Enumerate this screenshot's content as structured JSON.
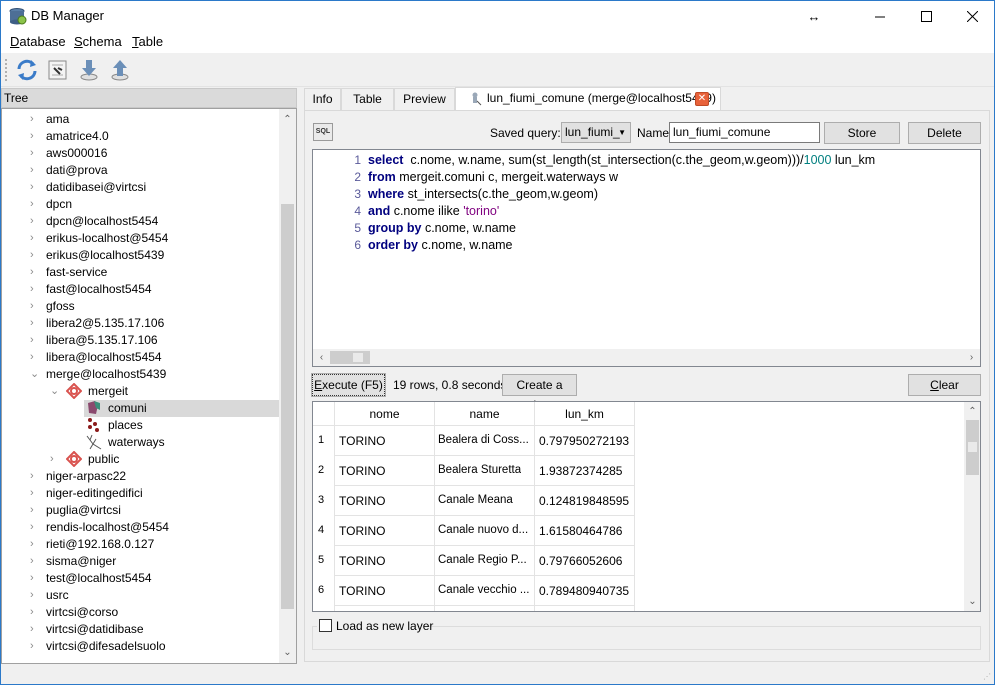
{
  "window": {
    "title": "DB Manager",
    "controls": {
      "resize": "↔",
      "minimize": "—",
      "maximize": "☐",
      "close": "✕"
    }
  },
  "menubar": {
    "items": [
      {
        "label_ul": "D",
        "label_rest": "atabase"
      },
      {
        "label_ul": "S",
        "label_rest": "chema"
      },
      {
        "label_ul": "T",
        "label_rest": "able"
      }
    ]
  },
  "toolbar": {
    "icons": [
      "refresh-icon",
      "sql-window-icon",
      "import-layer-icon",
      "export-layer-icon"
    ]
  },
  "tree": {
    "header": "Tree",
    "items": [
      {
        "label": "ama",
        "level": 0,
        "arrow": "›"
      },
      {
        "label": "amatrice4.0",
        "level": 0,
        "arrow": "›"
      },
      {
        "label": "aws000016",
        "level": 0,
        "arrow": "›"
      },
      {
        "label": "dati@prova",
        "level": 0,
        "arrow": "›"
      },
      {
        "label": "datidibasei@virtcsi",
        "level": 0,
        "arrow": "›"
      },
      {
        "label": "dpcn",
        "level": 0,
        "arrow": "›"
      },
      {
        "label": "dpcn@localhost5454",
        "level": 0,
        "arrow": "›"
      },
      {
        "label": "erikus-localhost@5454",
        "level": 0,
        "arrow": "›"
      },
      {
        "label": "erikus@localhost5439",
        "level": 0,
        "arrow": "›"
      },
      {
        "label": "fast-service",
        "level": 0,
        "arrow": "›"
      },
      {
        "label": "fast@localhost5454",
        "level": 0,
        "arrow": "›"
      },
      {
        "label": "gfoss",
        "level": 0,
        "arrow": "›"
      },
      {
        "label": "libera2@5.135.17.106",
        "level": 0,
        "arrow": "›"
      },
      {
        "label": "libera@5.135.17.106",
        "level": 0,
        "arrow": "›"
      },
      {
        "label": "libera@localhost5454",
        "level": 0,
        "arrow": "›"
      },
      {
        "label": "merge@localhost5439",
        "level": 0,
        "arrow": "⌄"
      },
      {
        "label": "mergeit",
        "level": 1,
        "arrow": "⌄",
        "icon": "schema-icon"
      },
      {
        "label": "comuni",
        "level": 2,
        "arrow": "",
        "icon": "polygon-layer-icon",
        "selected": true
      },
      {
        "label": "places",
        "level": 2,
        "arrow": "",
        "icon": "point-layer-icon"
      },
      {
        "label": "waterways",
        "level": 2,
        "arrow": "",
        "icon": "line-layer-icon"
      },
      {
        "label": "public",
        "level": 1,
        "arrow": "›",
        "icon": "schema-icon"
      },
      {
        "label": "niger-arpasc22",
        "level": 0,
        "arrow": "›"
      },
      {
        "label": "niger-editingedifici",
        "level": 0,
        "arrow": "›"
      },
      {
        "label": "puglia@virtcsi",
        "level": 0,
        "arrow": "›"
      },
      {
        "label": "rendis-localhost@5454",
        "level": 0,
        "arrow": "›"
      },
      {
        "label": "rieti@192.168.0.127",
        "level": 0,
        "arrow": "›"
      },
      {
        "label": "sisma@niger",
        "level": 0,
        "arrow": "›"
      },
      {
        "label": "test@localhost5454",
        "level": 0,
        "arrow": "›"
      },
      {
        "label": "usrc",
        "level": 0,
        "arrow": "›"
      },
      {
        "label": "virtcsi@corso",
        "level": 0,
        "arrow": "›"
      },
      {
        "label": "virtcsi@datidibase",
        "level": 0,
        "arrow": "›"
      },
      {
        "label": "virtcsi@difesadelsuolo",
        "level": 0,
        "arrow": "›"
      }
    ]
  },
  "tabs": [
    {
      "label": "Info"
    },
    {
      "label": "Table"
    },
    {
      "label": "Preview"
    },
    {
      "label": "lun_fiumi_comune (merge@localhost5439)",
      "active": true
    }
  ],
  "query": {
    "sql_icon_text": "SQL",
    "saved_query_label": "Saved query:",
    "saved_query_value": "lun_fiumi_",
    "name_label": "Name",
    "name_value": "lun_fiumi_comune",
    "store_label": "Store",
    "delete_label": "Delete"
  },
  "editor": {
    "lines": [
      [
        {
          "t": "select",
          "c": "kw"
        },
        {
          "t": "  c.nome, w.name, sum(st_length(st_intersection(c.the_geom,w.geom)))/",
          "c": ""
        },
        {
          "t": "1000",
          "c": "num"
        },
        {
          "t": " lun_km",
          "c": ""
        }
      ],
      [
        {
          "t": "from",
          "c": "kw"
        },
        {
          "t": " mergeit.comuni c, mergeit.waterways w",
          "c": ""
        }
      ],
      [
        {
          "t": "where",
          "c": "kw"
        },
        {
          "t": " st_intersects(c.the_geom,w.geom)",
          "c": ""
        }
      ],
      [
        {
          "t": "and",
          "c": "kw"
        },
        {
          "t": " c.nome ilike ",
          "c": ""
        },
        {
          "t": "'torino'",
          "c": "str"
        }
      ],
      [
        {
          "t": "group by",
          "c": "kw"
        },
        {
          "t": " c.nome, w.name",
          "c": ""
        }
      ],
      [
        {
          "t": "order by",
          "c": "kw"
        },
        {
          "t": " c.nome, w.name",
          "c": ""
        }
      ]
    ]
  },
  "execution": {
    "execute_label_ul": "E",
    "execute_label_rest": "xecute (F5)",
    "status": "19 rows, 0.8 seconds",
    "create_view_label": "Create a view",
    "clear_label_ul": "C",
    "clear_label_rest": "lear"
  },
  "results": {
    "columns": [
      "nome",
      "name",
      "lun_km"
    ],
    "rows": [
      {
        "n": "1",
        "nome": "TORINO",
        "name": "Bealera di Coss...",
        "lun_km": "0.797950272193"
      },
      {
        "n": "2",
        "nome": "TORINO",
        "name": "Bealera Sturetta",
        "lun_km": "1.93872374285"
      },
      {
        "n": "3",
        "nome": "TORINO",
        "name": "Canale Meana",
        "lun_km": "0.124819848595"
      },
      {
        "n": "4",
        "nome": "TORINO",
        "name": "Canale nuovo d...",
        "lun_km": "1.61580464786"
      },
      {
        "n": "5",
        "nome": "TORINO",
        "name": "Canale Regio P...",
        "lun_km": "0.79766052606"
      },
      {
        "n": "6",
        "nome": "TORINO",
        "name": "Canale vecchio ...",
        "lun_km": "0.789480940735"
      }
    ]
  },
  "load_layer": {
    "label": "Load as new layer",
    "checked": false
  }
}
